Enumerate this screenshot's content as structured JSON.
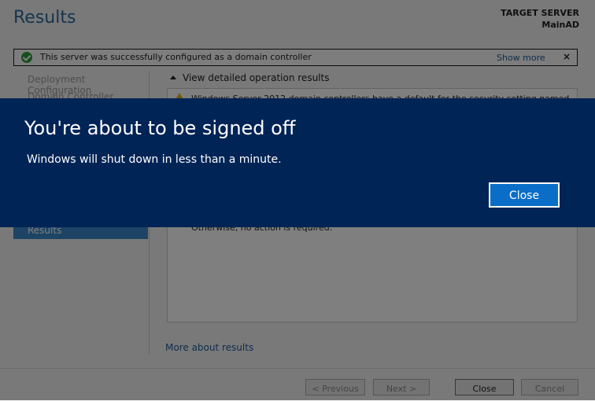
{
  "wizard": {
    "title": "Results",
    "target_server_label": "TARGET SERVER",
    "target_server_name": "MainAD",
    "notification": {
      "message": "This server was successfully configured as a domain controller",
      "show_more": "Show more",
      "close": "×"
    },
    "sidebar": {
      "items": [
        {
          "label": "Deployment Configuration"
        },
        {
          "label": "Domain Controller Options"
        },
        {
          "label": "Results",
          "selected": true
        }
      ]
    },
    "view_results_label": "View detailed operation results",
    "results": {
      "warning_text": "Windows Server 2012 domain controllers have a default for the security setting named",
      "footer_text": "Otherwise, no action is required."
    },
    "more_about_link": "More about results",
    "buttons": {
      "previous": "< Previous",
      "next": "Next >",
      "close": "Close",
      "cancel": "Cancel"
    }
  },
  "signoff_dialog": {
    "heading": "You're about to be signed off",
    "message": "Windows will shut down in less than a minute.",
    "close_button": "Close"
  },
  "colors": {
    "banner_bg": "#012456",
    "button_blue": "#0a6ec8",
    "accent": "#3a89c9"
  }
}
